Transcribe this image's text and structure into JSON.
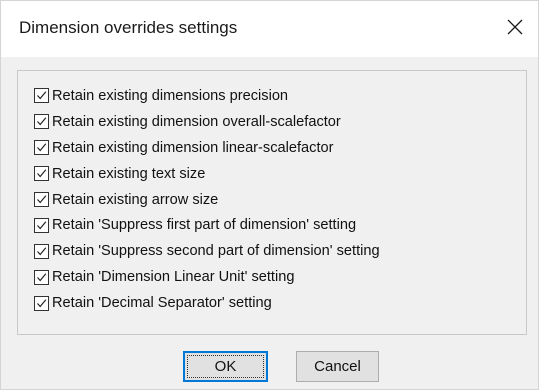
{
  "dialog": {
    "title": "Dimension overrides settings",
    "close_icon": "close-icon"
  },
  "options": [
    {
      "label": "Retain existing dimensions precision",
      "checked": true
    },
    {
      "label": "Retain existing dimension overall-scalefactor",
      "checked": true
    },
    {
      "label": "Retain existing dimension linear-scalefactor",
      "checked": true
    },
    {
      "label": "Retain existing text size",
      "checked": true
    },
    {
      "label": "Retain existing arrow size",
      "checked": true
    },
    {
      "label": "Retain 'Suppress first part of dimension' setting",
      "checked": true
    },
    {
      "label": "Retain 'Suppress second part of dimension' setting",
      "checked": true
    },
    {
      "label": "Retain 'Dimension Linear Unit' setting",
      "checked": true
    },
    {
      "label": "Retain 'Decimal Separator' setting",
      "checked": true
    }
  ],
  "buttons": {
    "ok_label": "OK",
    "cancel_label": "Cancel"
  },
  "colors": {
    "dialog_background": "#f0f0f0",
    "titlebar_background": "#ffffff",
    "focus_border": "#0078d7"
  }
}
